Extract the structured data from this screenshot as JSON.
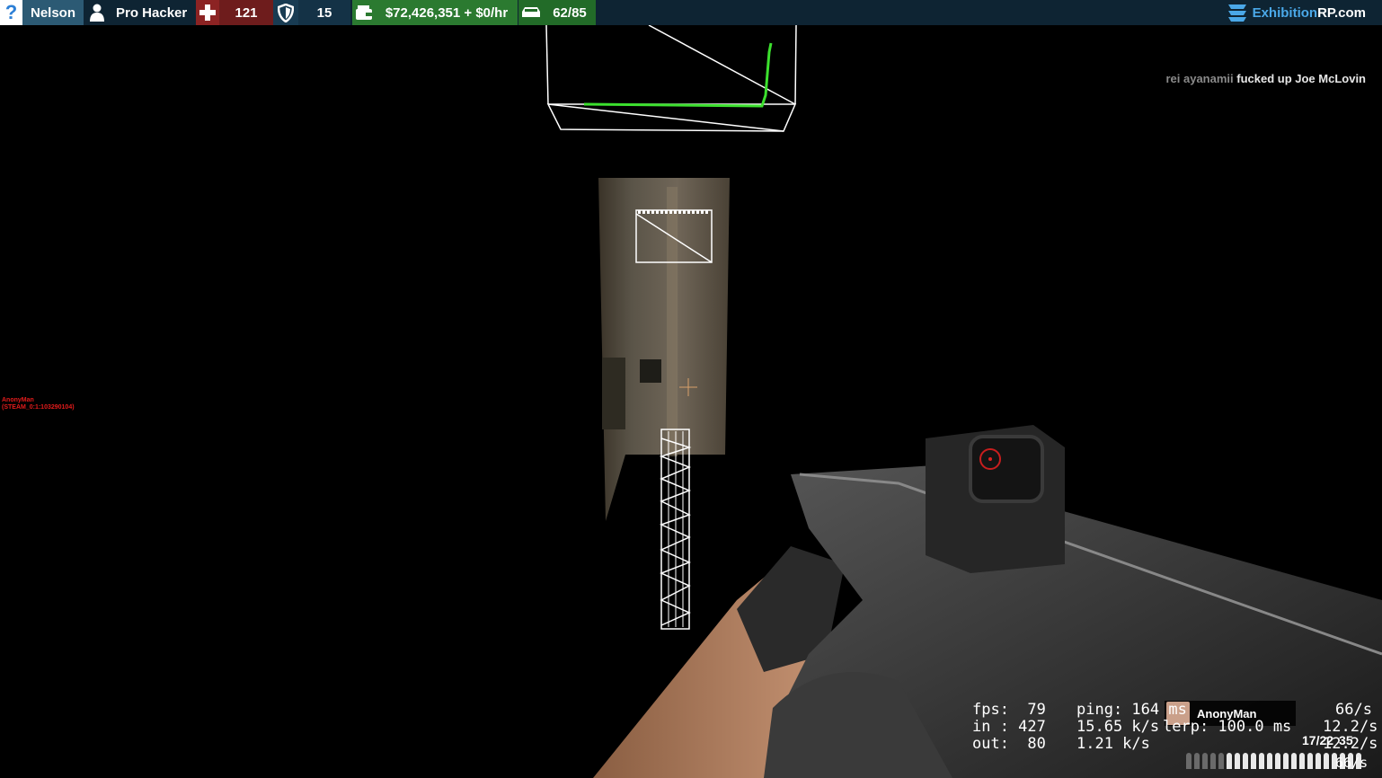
{
  "hud": {
    "help_glyph": "?",
    "player_name": "Nelson",
    "job": "Pro Hacker",
    "health": "121",
    "armor": "15",
    "money": "$72,426,351 + $0/hr",
    "hunger": "62/85",
    "brand_part1": "Exhibition",
    "brand_part2": "RP.com",
    "icons": [
      "help-icon",
      "person-icon",
      "health-cross-icon",
      "shield-icon",
      "wallet-icon",
      "car-icon",
      "exhibition-logo-icon"
    ],
    "colors": {
      "bar": "#0e2433",
      "name": "#2c5a74",
      "health": "#6e1c1c",
      "money": "#2b7a30",
      "brand": "#4aa8e8"
    }
  },
  "killfeed": {
    "attacker": "rei ayanamii",
    "message": "fucked up Joe McLovin"
  },
  "esp": {
    "name": "AnonyMan",
    "steamid": "(STEAM_0:1:103290104)"
  },
  "voice": {
    "speaker": "AnonyMan"
  },
  "netgraph": {
    "fps": "fps:  79",
    "ping": "ping: 164 ms",
    "tick1": "66/s",
    "in": "in : 427",
    "in_rate": "15.65 k/s",
    "lerp": "lerp: 100.0 ms",
    "tick2": "12.2/s",
    "out": "out:  80",
    "out_rate": "1.21 k/s",
    "tick3": "12.2/s",
    "tick4": "66/s"
  },
  "ammo": {
    "clip": "17/22",
    "reserve": "35",
    "rounds_loaded": 17,
    "capacity": 22
  }
}
